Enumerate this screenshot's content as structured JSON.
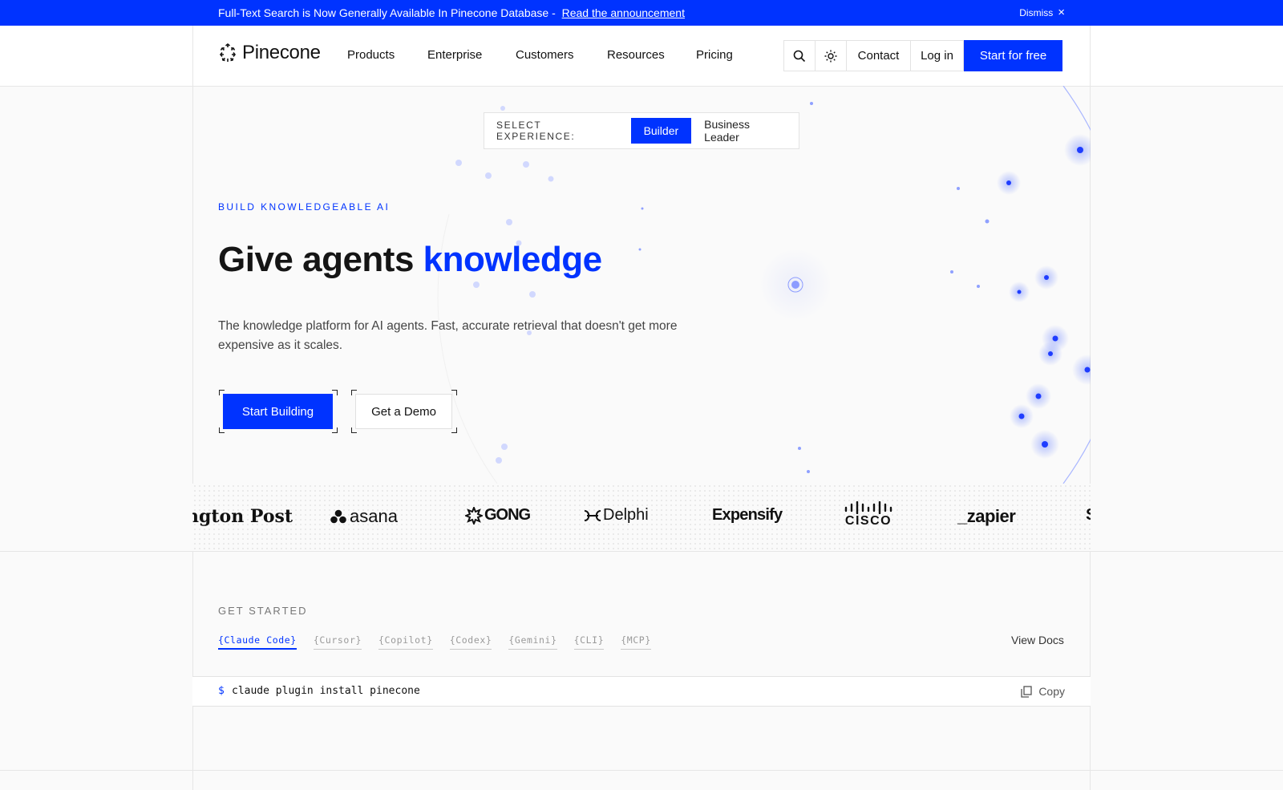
{
  "announcement": {
    "message": "Full-Text Search is Now Generally Available In Pinecone Database -",
    "link": "Read the announcement",
    "dismiss": "Dismiss"
  },
  "nav": {
    "logo": "Pinecone",
    "menu": [
      "Products",
      "Enterprise",
      "Customers",
      "Resources",
      "Pricing"
    ],
    "contact": "Contact",
    "login": "Log in",
    "start": "Start for free"
  },
  "hero": {
    "select_label": "SELECT EXPERIENCE:",
    "options": [
      "Builder",
      "Business Leader"
    ],
    "eyebrow": "BUILD KNOWLEDGEABLE AI",
    "headline_plain": "Give agents",
    "headline_accent": "knowledge",
    "subtitle": "The knowledge platform for AI agents. Fast, accurate retrieval that doesn't get more expensive as it scales.",
    "cta_primary": "Start Building",
    "cta_secondary": "Get a Demo"
  },
  "logos": {
    "washington_post": "ngton Post",
    "asana": "asana",
    "gong": "GONG",
    "delphi": "Delphi",
    "expensify": "Expensify",
    "cisco": "CISCO",
    "zapier": "_zapier",
    "partial": "S"
  },
  "get_started": {
    "title": "GET STARTED",
    "tabs": [
      "{Claude Code}",
      "{Cursor}",
      "{Copilot}",
      "{Codex}",
      "{Gemini}",
      "{CLI}",
      "{MCP}"
    ],
    "view_docs": "View Docs",
    "prompt": "$",
    "command": "claude plugin install pinecone",
    "copy": "Copy"
  },
  "colors": {
    "brand": "#0033ff",
    "border": "#e3e3e3",
    "background": "#fafafa"
  }
}
